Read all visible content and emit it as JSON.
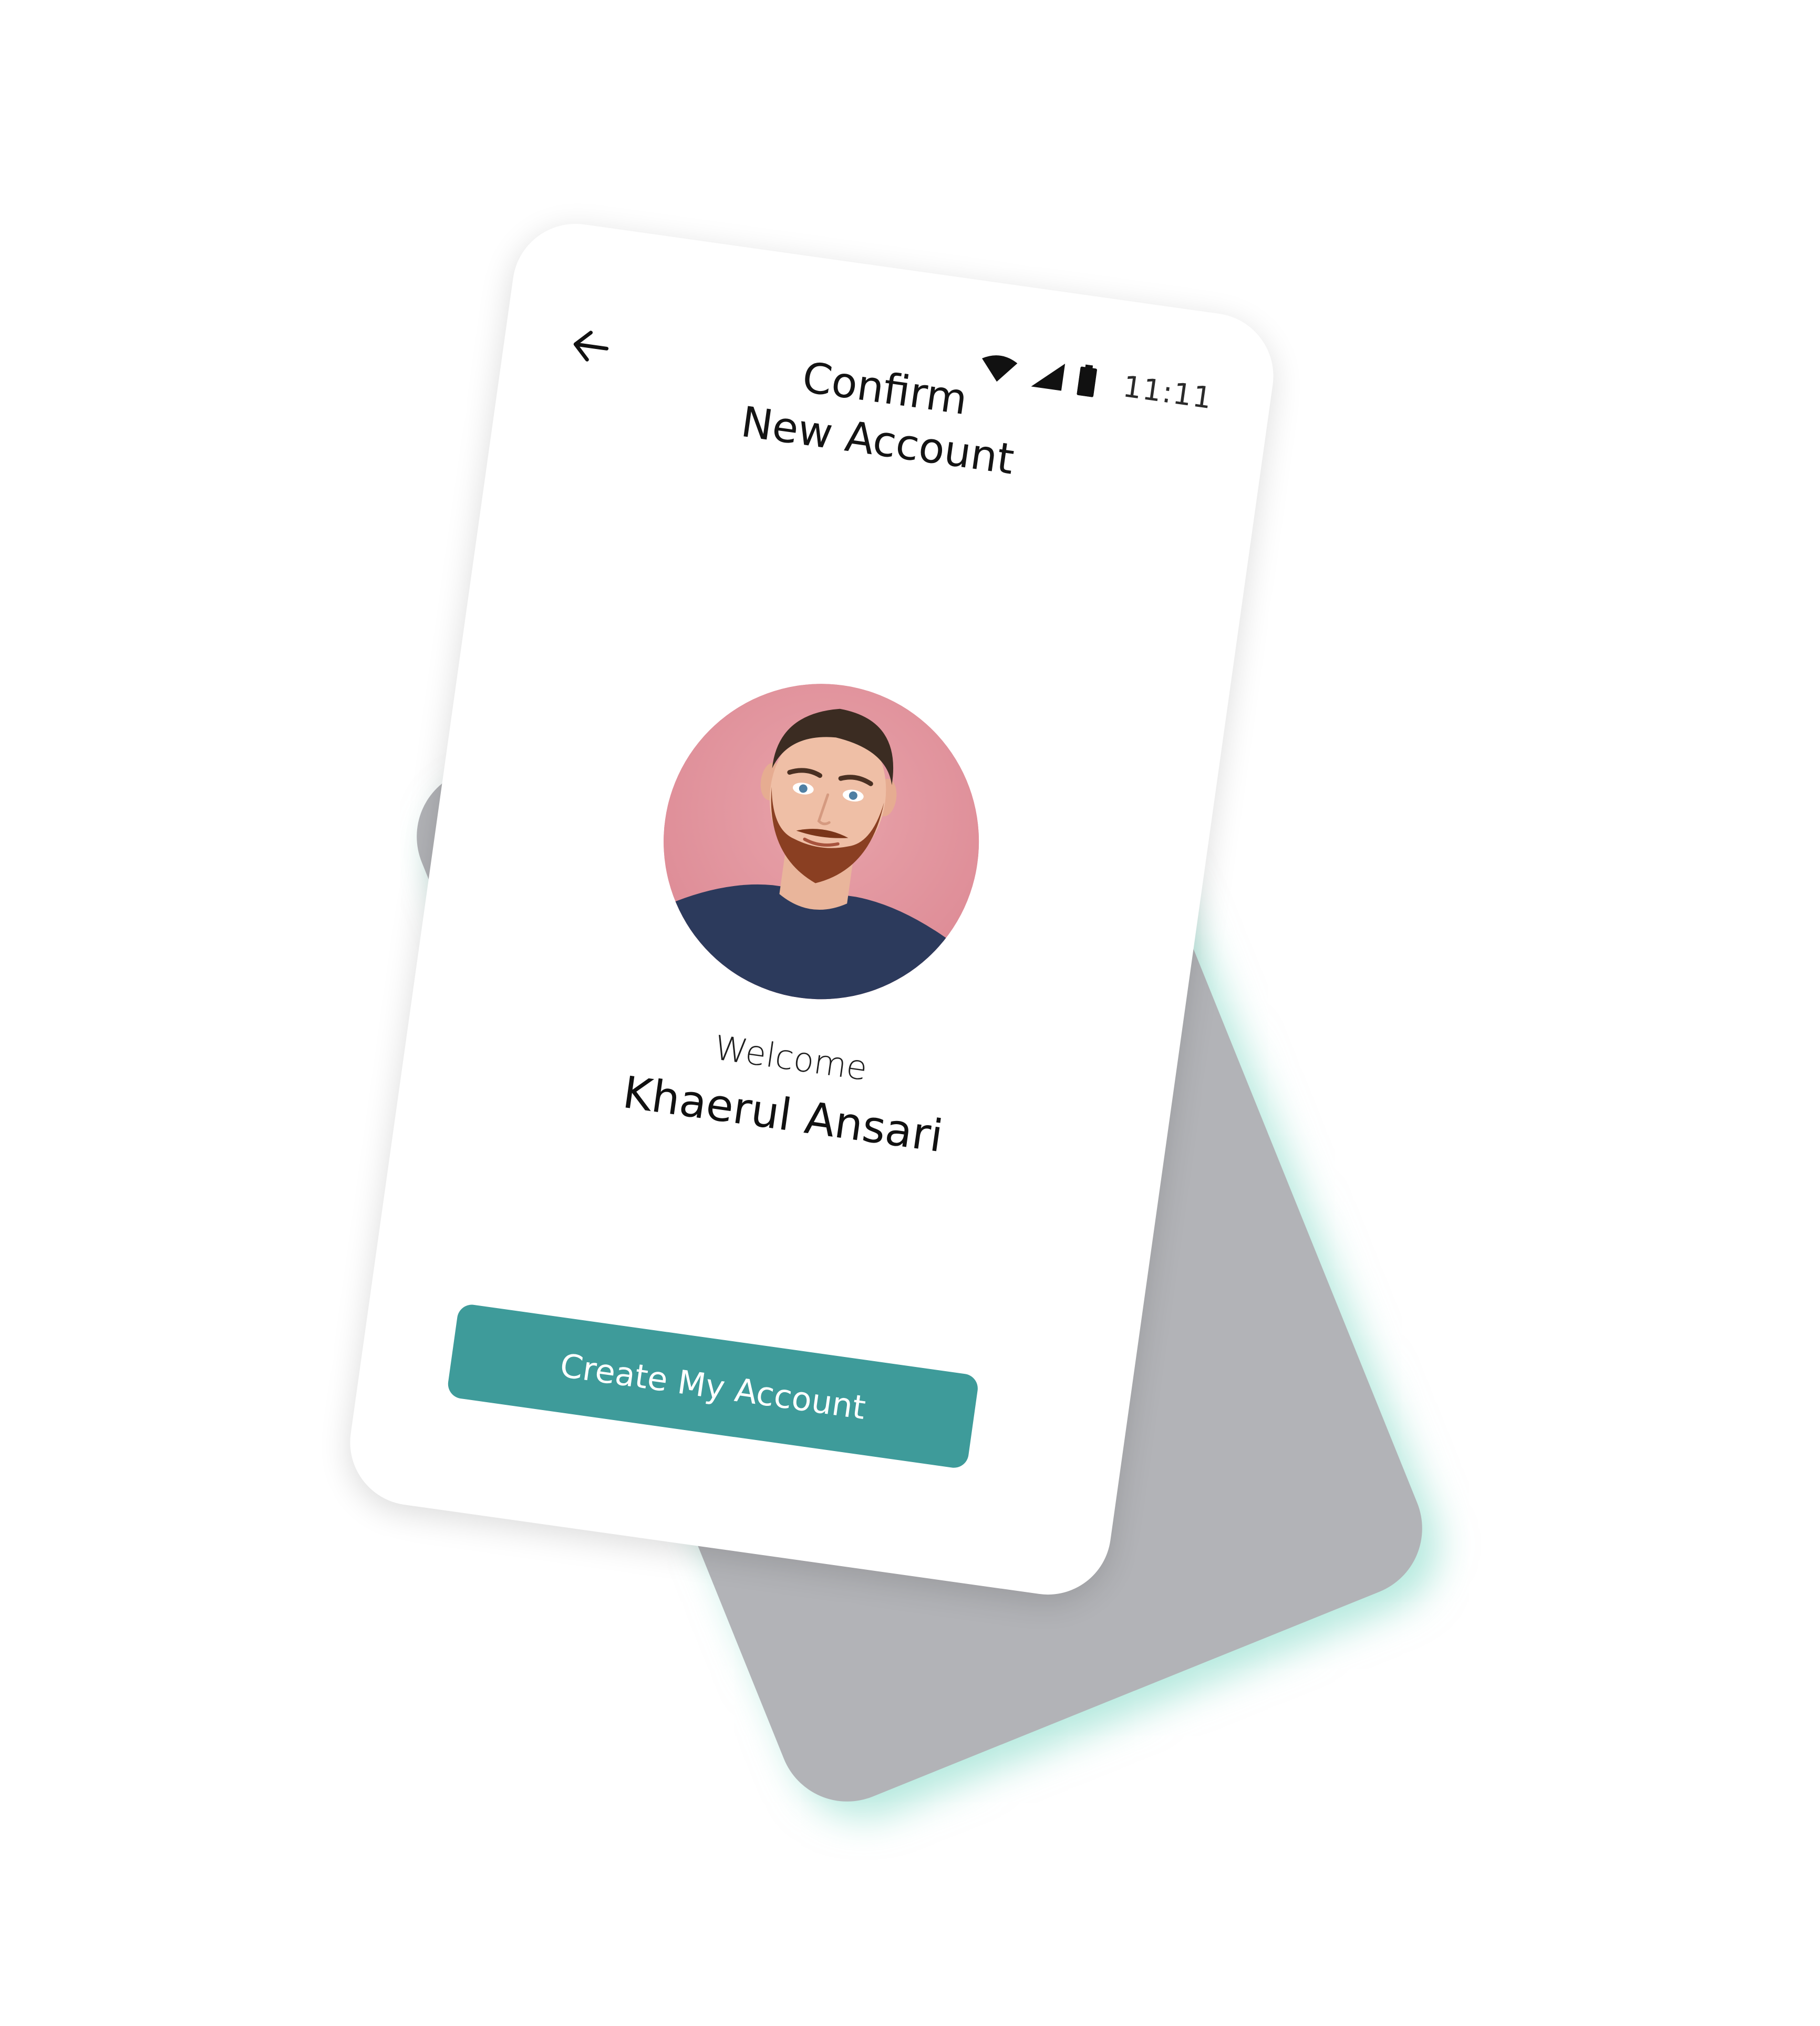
{
  "status_bar": {
    "time": "11:11",
    "icons": [
      "wifi-icon",
      "signal-icon",
      "battery-icon"
    ]
  },
  "header": {
    "back_icon": "arrow-left-icon",
    "title_line1": "Confirm",
    "title_line2": "New Account"
  },
  "profile": {
    "welcome": "Welcome",
    "name": "Khaerul Ansari"
  },
  "actions": {
    "create_label": "Create My Account"
  },
  "colors": {
    "accent": "#3e9b9a",
    "back_card": "#b2b3b7",
    "avatar_bg": "#e2949c",
    "shirt": "#2c3a5c",
    "beard": "#8a3f22",
    "hair": "#3b2c22"
  }
}
